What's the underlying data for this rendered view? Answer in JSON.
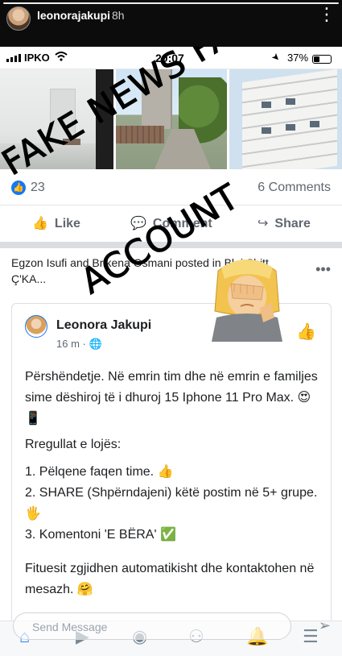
{
  "story": {
    "username": "leonorajakupi",
    "time_ago": "8h",
    "more_icon": "more-dots-icon"
  },
  "phone_status": {
    "carrier": "IPKO",
    "clock": "20:07",
    "battery_percent": "37%",
    "battery_level": 0.37
  },
  "post": {
    "like_count": "23",
    "comment_count": "6 Comments",
    "actions": {
      "like": "Like",
      "comment": "Comment",
      "share": "Share"
    }
  },
  "shared_post": {
    "header": "Egzon Isufi and Brikena Osmani posted in Blej Shitt Ç'KA...",
    "author": "Leonora Jakupi",
    "time": "16 m",
    "paragraph_1": "Përshëndetje. Në emrin tim dhe në emrin e familjes sime dëshiroj të i dhuroj 15 Iphone 11 Pro Max. 😍📱",
    "rules_title": "Rregullat e lojës:",
    "rule_1": "1. Pëlqene faqen time. 👍",
    "rule_2": "2. SHARE (Shpërndajeni) këtë postim në 5+ grupe. 🖐",
    "rule_3": "3. Komentoni 'E BËRA' ✅",
    "paragraph_2": "Fituesit zgjidhen automatikisht dhe kontaktohen në mesazh. 🤗"
  },
  "overlay": {
    "line_1": "FAKE NEWS FAKE",
    "line_2": "ACCOUNT"
  },
  "reply": {
    "placeholder": "Send Message"
  },
  "colors": {
    "facebook_blue": "#1877f2",
    "text_gray": "#606770"
  }
}
